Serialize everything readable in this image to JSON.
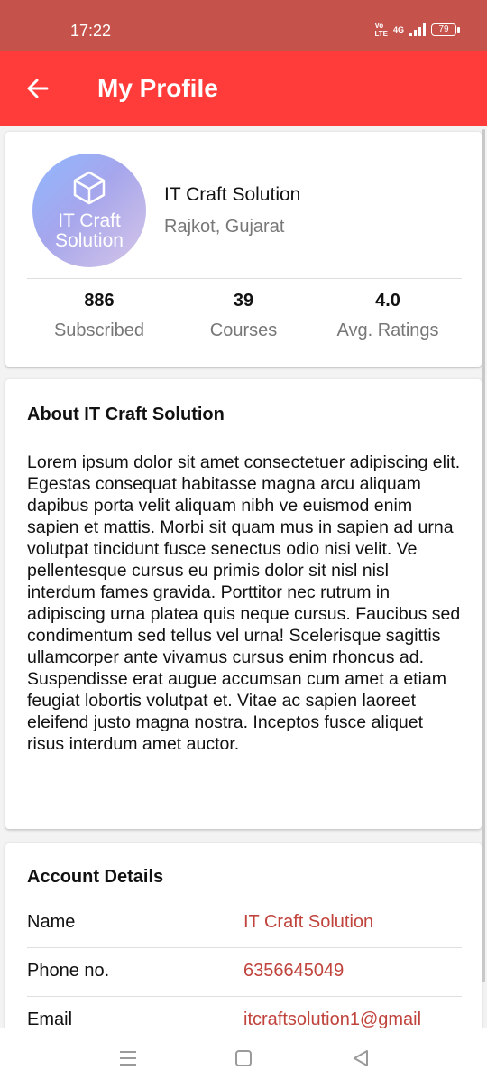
{
  "status_bar": {
    "time": "17:22",
    "net_top": "Vo",
    "net_bottom": "LTE",
    "network": "4G",
    "battery": "79"
  },
  "app_bar": {
    "title": "My Profile",
    "back_icon": "arrow-left-icon"
  },
  "profile": {
    "logo_line1": "IT Craft",
    "logo_line2": "Solution",
    "name": "IT Craft Solution",
    "location": "Rajkot, Gujarat",
    "stats": [
      {
        "value": "886",
        "label": "Subscribed"
      },
      {
        "value": "39",
        "label": "Courses"
      },
      {
        "value": "4.0",
        "label": "Avg. Ratings"
      }
    ]
  },
  "about": {
    "title": "About IT Craft Solution",
    "text": "Lorem ipsum dolor sit amet consectetuer adipiscing elit. Egestas consequat habitasse magna arcu aliquam dapibus porta velit aliquam nibh ve euismod enim sapien et mattis. Morbi sit quam mus in sapien ad urna volutpat tincidunt fusce senectus odio nisi velit. Ve pellentesque cursus eu primis dolor sit nisl nisl interdum fames gravida. Porttitor nec rutrum in adipiscing urna platea quis neque cursus. Faucibus sed condimentum sed tellus vel urna! Scelerisque sagittis ullamcorper ante vivamus cursus enim rhoncus ad. Suspendisse erat augue accumsan cum amet a etiam feugiat lobortis volutpat et. Vitae ac sapien laoreet eleifend justo magna nostra. Inceptos fusce aliquet risus interdum amet auctor."
  },
  "account": {
    "title": "Account Details",
    "rows": [
      {
        "label": "Name",
        "value": "IT Craft Solution"
      },
      {
        "label": "Phone no.",
        "value": "6356645049"
      },
      {
        "label": "Email",
        "value": "itcraftsolution1@gmail"
      }
    ]
  },
  "colors": {
    "app_bar": "#ff3c3a",
    "status_bar": "#c5534c",
    "accent_text": "#c0433c"
  },
  "nav_bar": {
    "icons": [
      "menu-icon",
      "home-square-icon",
      "back-triangle-icon"
    ]
  }
}
